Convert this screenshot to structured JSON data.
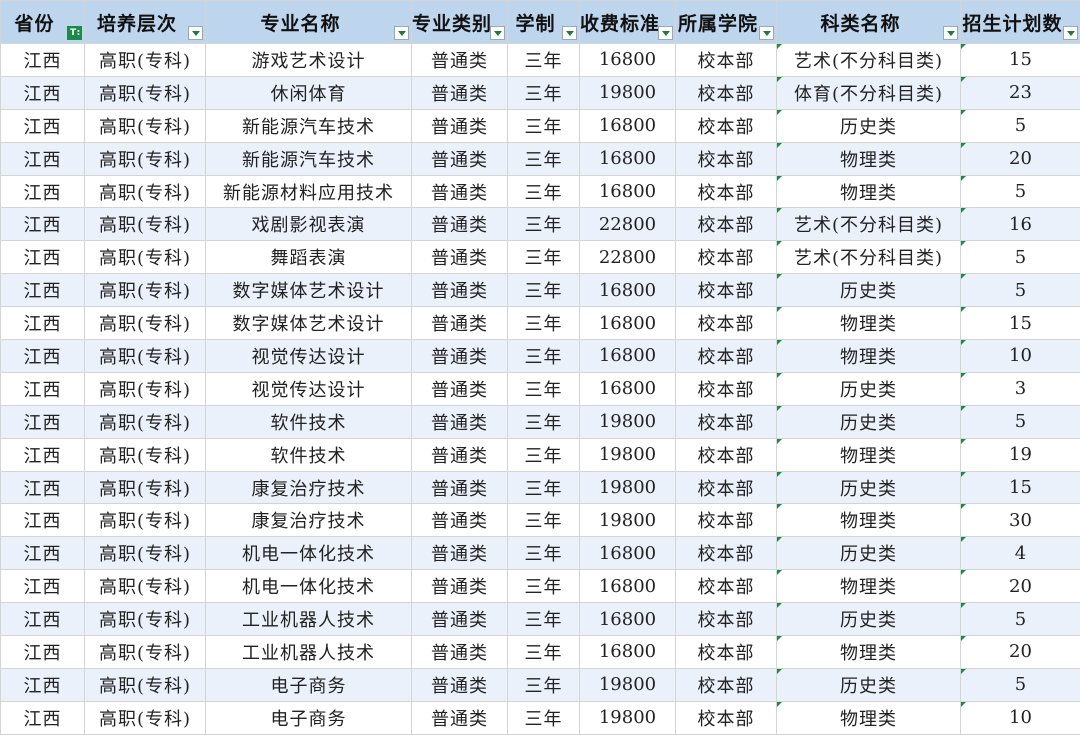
{
  "headers": [
    "省份",
    "培养层次",
    "专业名称",
    "专业类别",
    "学制",
    "收费标准",
    "所属学院",
    "科类名称",
    "招生计划数"
  ],
  "rows": [
    [
      "江西",
      "高职(专科)",
      "游戏艺术设计",
      "普通类",
      "三年",
      "16800",
      "校本部",
      "艺术(不分科目类)",
      "15"
    ],
    [
      "江西",
      "高职(专科)",
      "休闲体育",
      "普通类",
      "三年",
      "19800",
      "校本部",
      "体育(不分科目类)",
      "23"
    ],
    [
      "江西",
      "高职(专科)",
      "新能源汽车技术",
      "普通类",
      "三年",
      "16800",
      "校本部",
      "历史类",
      "5"
    ],
    [
      "江西",
      "高职(专科)",
      "新能源汽车技术",
      "普通类",
      "三年",
      "16800",
      "校本部",
      "物理类",
      "20"
    ],
    [
      "江西",
      "高职(专科)",
      "新能源材料应用技术",
      "普通类",
      "三年",
      "16800",
      "校本部",
      "物理类",
      "5"
    ],
    [
      "江西",
      "高职(专科)",
      "戏剧影视表演",
      "普通类",
      "三年",
      "22800",
      "校本部",
      "艺术(不分科目类)",
      "16"
    ],
    [
      "江西",
      "高职(专科)",
      "舞蹈表演",
      "普通类",
      "三年",
      "22800",
      "校本部",
      "艺术(不分科目类)",
      "5"
    ],
    [
      "江西",
      "高职(专科)",
      "数字媒体艺术设计",
      "普通类",
      "三年",
      "16800",
      "校本部",
      "历史类",
      "5"
    ],
    [
      "江西",
      "高职(专科)",
      "数字媒体艺术设计",
      "普通类",
      "三年",
      "16800",
      "校本部",
      "物理类",
      "15"
    ],
    [
      "江西",
      "高职(专科)",
      "视觉传达设计",
      "普通类",
      "三年",
      "16800",
      "校本部",
      "物理类",
      "10"
    ],
    [
      "江西",
      "高职(专科)",
      "视觉传达设计",
      "普通类",
      "三年",
      "16800",
      "校本部",
      "历史类",
      "3"
    ],
    [
      "江西",
      "高职(专科)",
      "软件技术",
      "普通类",
      "三年",
      "19800",
      "校本部",
      "历史类",
      "5"
    ],
    [
      "江西",
      "高职(专科)",
      "软件技术",
      "普通类",
      "三年",
      "19800",
      "校本部",
      "物理类",
      "19"
    ],
    [
      "江西",
      "高职(专科)",
      "康复治疗技术",
      "普通类",
      "三年",
      "19800",
      "校本部",
      "历史类",
      "15"
    ],
    [
      "江西",
      "高职(专科)",
      "康复治疗技术",
      "普通类",
      "三年",
      "19800",
      "校本部",
      "物理类",
      "30"
    ],
    [
      "江西",
      "高职(专科)",
      "机电一体化技术",
      "普通类",
      "三年",
      "16800",
      "校本部",
      "历史类",
      "4"
    ],
    [
      "江西",
      "高职(专科)",
      "机电一体化技术",
      "普通类",
      "三年",
      "16800",
      "校本部",
      "物理类",
      "20"
    ],
    [
      "江西",
      "高职(专科)",
      "工业机器人技术",
      "普通类",
      "三年",
      "16800",
      "校本部",
      "历史类",
      "5"
    ],
    [
      "江西",
      "高职(专科)",
      "工业机器人技术",
      "普通类",
      "三年",
      "16800",
      "校本部",
      "物理类",
      "20"
    ],
    [
      "江西",
      "高职(专科)",
      "电子商务",
      "普通类",
      "三年",
      "19800",
      "校本部",
      "历史类",
      "5"
    ],
    [
      "江西",
      "高职(专科)",
      "电子商务",
      "普通类",
      "三年",
      "19800",
      "校本部",
      "物理类",
      "10"
    ]
  ]
}
